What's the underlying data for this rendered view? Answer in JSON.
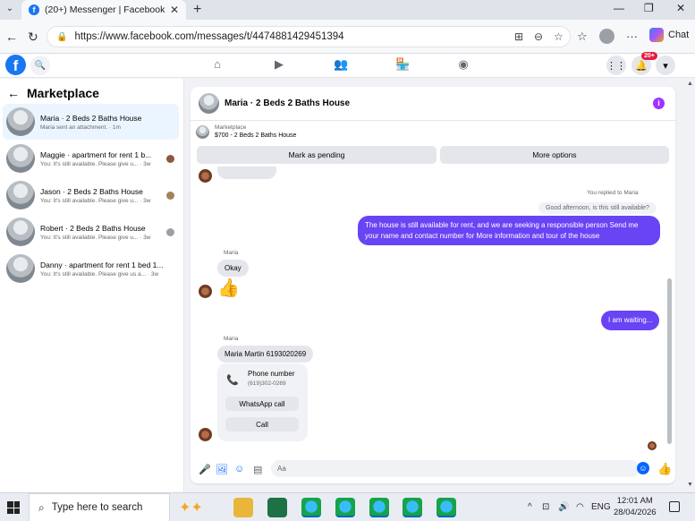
{
  "browser": {
    "tab_title": "(20+) Messenger | Facebook",
    "tab_close": "✕",
    "new_tab": "+",
    "url": "https://www.facebook.com/messages/t/4474881429451394",
    "chat_label": "Chat",
    "win_min": "—",
    "win_max": "❐",
    "win_close": "✕"
  },
  "fb": {
    "logo": "f",
    "notif_count": "20+",
    "nav_icons": [
      "home-icon",
      "video-icon",
      "friends-icon",
      "marketplace-icon",
      "groups-icon"
    ]
  },
  "sidebar": {
    "title": "Marketplace",
    "conversations": [
      {
        "name": "Maria · 2 Beds 2 Baths House",
        "snippet": "Maria sent an attachment. · 1m",
        "active": true
      },
      {
        "name": "Maggie · apartment for rent 1 b...",
        "snippet": "You: It's still available. Please give u... · 3w"
      },
      {
        "name": "Jason · 2 Beds 2 Baths House",
        "snippet": "You: It's still available. Please give u... · 3w"
      },
      {
        "name": "Robert · 2 Beds 2 Baths House",
        "snippet": "You: It's still available. Please give u... · 3w"
      },
      {
        "name": "Danny · apartment for rent 1 bed 1...",
        "snippet": "You: It's still available. Please give us a... · 3w"
      }
    ]
  },
  "chat": {
    "title": "Maria · 2 Beds 2 Baths House",
    "marketplace_label": "Marketplace",
    "listing": "$700 - 2 Beds 2 Baths House",
    "mark_pending": "Mark as pending",
    "more_options": "More options",
    "replied_to": "You replied to Maria",
    "quoted": "Good afternoon, is this still available?",
    "out_msg_1": "The  house is still available for rent, and we are seeking a responsible person  Send me your name and contact number for More information and tour of the house",
    "sender_1": "Maria",
    "in_msg_1": "Okay",
    "thumbs": "👍",
    "out_msg_2": "I am waiting...",
    "sender_2": "Maria",
    "in_msg_2": "Maria Martin 6193020269",
    "contact": {
      "title": "Phone number",
      "number": "(619)302-0269",
      "whatsapp": "WhatsApp call",
      "call": "Call"
    },
    "composer_placeholder": "Aa"
  },
  "taskbar": {
    "search_placeholder": "Type here to search",
    "lang": "ENG",
    "time": "12:01 AM",
    "date": "28/04/2026"
  }
}
